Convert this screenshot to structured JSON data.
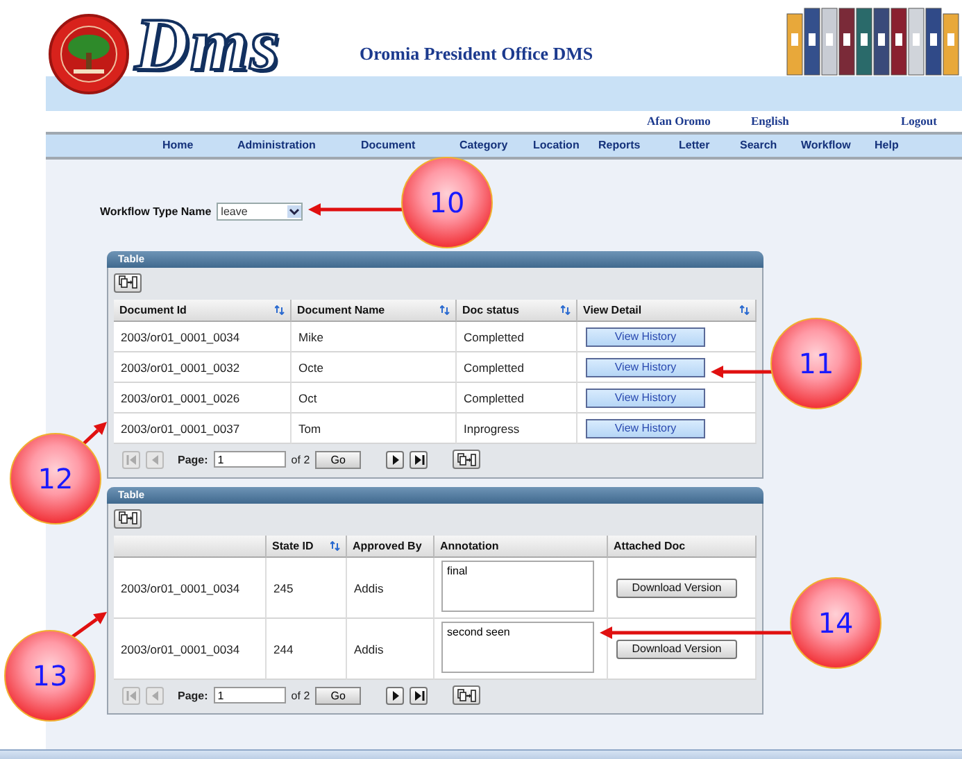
{
  "header": {
    "logo_text": "Dms",
    "title": "Oromia President Office DMS"
  },
  "top_links": [
    "Afan Oromo",
    "English",
    "Logout"
  ],
  "nav": [
    "Home",
    "Administration",
    "Document",
    "Category",
    "Location",
    "Reports",
    "Letter",
    "Search",
    "Workflow",
    "Help"
  ],
  "filter": {
    "label": "Workflow Type Name",
    "value": "leave"
  },
  "documents_table": {
    "title": "Table",
    "columns": [
      {
        "label": "Document Id",
        "sortable": true
      },
      {
        "label": "Document Name",
        "sortable": true
      },
      {
        "label": "Doc status",
        "sortable": true
      },
      {
        "label": "View Detail",
        "sortable": true
      }
    ],
    "rows": [
      {
        "cells": [
          {
            "kind": "text",
            "text": "2003/or01_0001_0034"
          },
          {
            "kind": "text",
            "text": "Mike"
          },
          {
            "kind": "text",
            "text": "Completted"
          },
          {
            "kind": "button",
            "text": "View History"
          }
        ]
      },
      {
        "cells": [
          {
            "kind": "text",
            "text": "2003/or01_0001_0032"
          },
          {
            "kind": "text",
            "text": "Octe"
          },
          {
            "kind": "text",
            "text": "Completted"
          },
          {
            "kind": "button",
            "text": "View History"
          }
        ]
      },
      {
        "cells": [
          {
            "kind": "text",
            "text": "2003/or01_0001_0026"
          },
          {
            "kind": "text",
            "text": "Oct"
          },
          {
            "kind": "text",
            "text": "Completted"
          },
          {
            "kind": "button",
            "text": "View History"
          }
        ]
      },
      {
        "cells": [
          {
            "kind": "text",
            "text": "2003/or01_0001_0037"
          },
          {
            "kind": "text",
            "text": "Tom"
          },
          {
            "kind": "text",
            "text": "Inprogress"
          },
          {
            "kind": "button",
            "text": "View History"
          }
        ]
      }
    ],
    "pager": {
      "label": "Page:",
      "value": "1",
      "total": "of 2",
      "go": "Go",
      "controls": [
        {
          "kind": "first",
          "disabled": true
        },
        {
          "kind": "prev",
          "disabled": true
        },
        {
          "kind": "next",
          "disabled": false
        },
        {
          "kind": "last",
          "disabled": false
        }
      ]
    }
  },
  "history_table": {
    "title": "Table",
    "columns": [
      {
        "sortable": false
      },
      {
        "label": "State ID",
        "sortable": true
      },
      {
        "label": "Approved By",
        "sortable": false
      },
      {
        "label": "Annotation",
        "sortable": false
      },
      {
        "label": "Attached Doc",
        "sortable": false
      }
    ],
    "rows": [
      {
        "cells": [
          {
            "kind": "text",
            "text": "2003/or01_0001_0034"
          },
          {
            "kind": "text",
            "text": "245"
          },
          {
            "kind": "text",
            "text": "Addis"
          },
          {
            "kind": "textarea",
            "text": "final"
          },
          {
            "kind": "button",
            "text": "Download Version"
          }
        ]
      },
      {
        "cells": [
          {
            "kind": "text",
            "text": "2003/or01_0001_0034"
          },
          {
            "kind": "text",
            "text": "244"
          },
          {
            "kind": "text",
            "text": "Addis"
          },
          {
            "kind": "textarea",
            "text": "second seen"
          },
          {
            "kind": "button",
            "text": "Download Version"
          }
        ]
      }
    ],
    "pager": {
      "label": "Page:",
      "value": "1",
      "total": "of 2",
      "go": "Go",
      "controls": [
        {
          "kind": "first",
          "disabled": true
        },
        {
          "kind": "prev",
          "disabled": true
        },
        {
          "kind": "next",
          "disabled": false
        },
        {
          "kind": "last",
          "disabled": false
        }
      ]
    }
  },
  "callouts": [
    {
      "number": "10"
    },
    {
      "number": "11"
    },
    {
      "number": "12"
    },
    {
      "number": "13"
    },
    {
      "number": "14"
    }
  ]
}
